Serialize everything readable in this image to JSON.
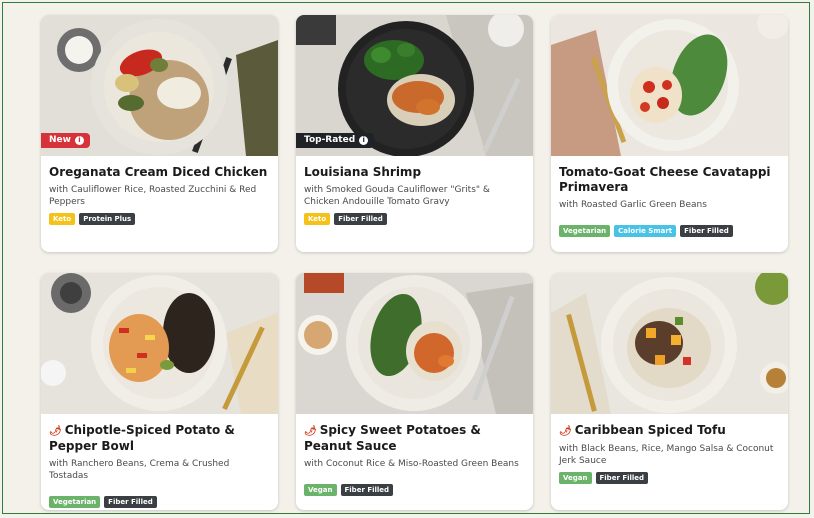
{
  "cards": [
    {
      "title": "Oreganata Cream Diced Chicken",
      "subtitle": "with Cauliflower Rice, Roasted Zucchini & Red Peppers",
      "flag": "New",
      "tags": [
        "Keto",
        "Protein Plus"
      ]
    },
    {
      "title": "Louisiana Shrimp",
      "subtitle": "with Smoked Gouda Cauliflower \"Grits\" & Chicken Andouille Tomato Gravy",
      "flag": "Top-Rated",
      "tags": [
        "Keto",
        "Fiber Filled"
      ]
    },
    {
      "title": "Tomato-Goat Cheese Cavatappi Primavera",
      "subtitle": "with Roasted Garlic Green Beans",
      "tags": [
        "Vegetarian",
        "Calorie Smart",
        "Fiber Filled"
      ]
    },
    {
      "title": "Chipotle-Spiced Potato & Pepper Bowl",
      "subtitle": "with Ranchero Beans, Crema & Crushed Tostadas",
      "spicy": true,
      "tags": [
        "Vegetarian",
        "Fiber Filled"
      ]
    },
    {
      "title": "Spicy Sweet Potatoes & Peanut Sauce",
      "subtitle": "with Coconut Rice & Miso-Roasted Green Beans",
      "spicy": true,
      "tags": [
        "Vegan",
        "Fiber Filled"
      ]
    },
    {
      "title": "Caribbean Spiced Tofu",
      "subtitle": "with Black Beans, Rice, Mango Salsa & Coconut Jerk Sauce",
      "spicy": true,
      "tags": [
        "Vegan",
        "Fiber Filled"
      ]
    }
  ],
  "icons": {
    "flag_info": "i",
    "spicy": "chili-icon"
  },
  "colors": {
    "new_flag": "#d6323a",
    "top_rated_flag": "#1f2328",
    "keto": "#f5c21a",
    "vegetarian": "#6bb36a",
    "calorie_smart": "#48c3e6",
    "dark_tag": "#3a3f44",
    "spicy": "#d23a1c"
  }
}
